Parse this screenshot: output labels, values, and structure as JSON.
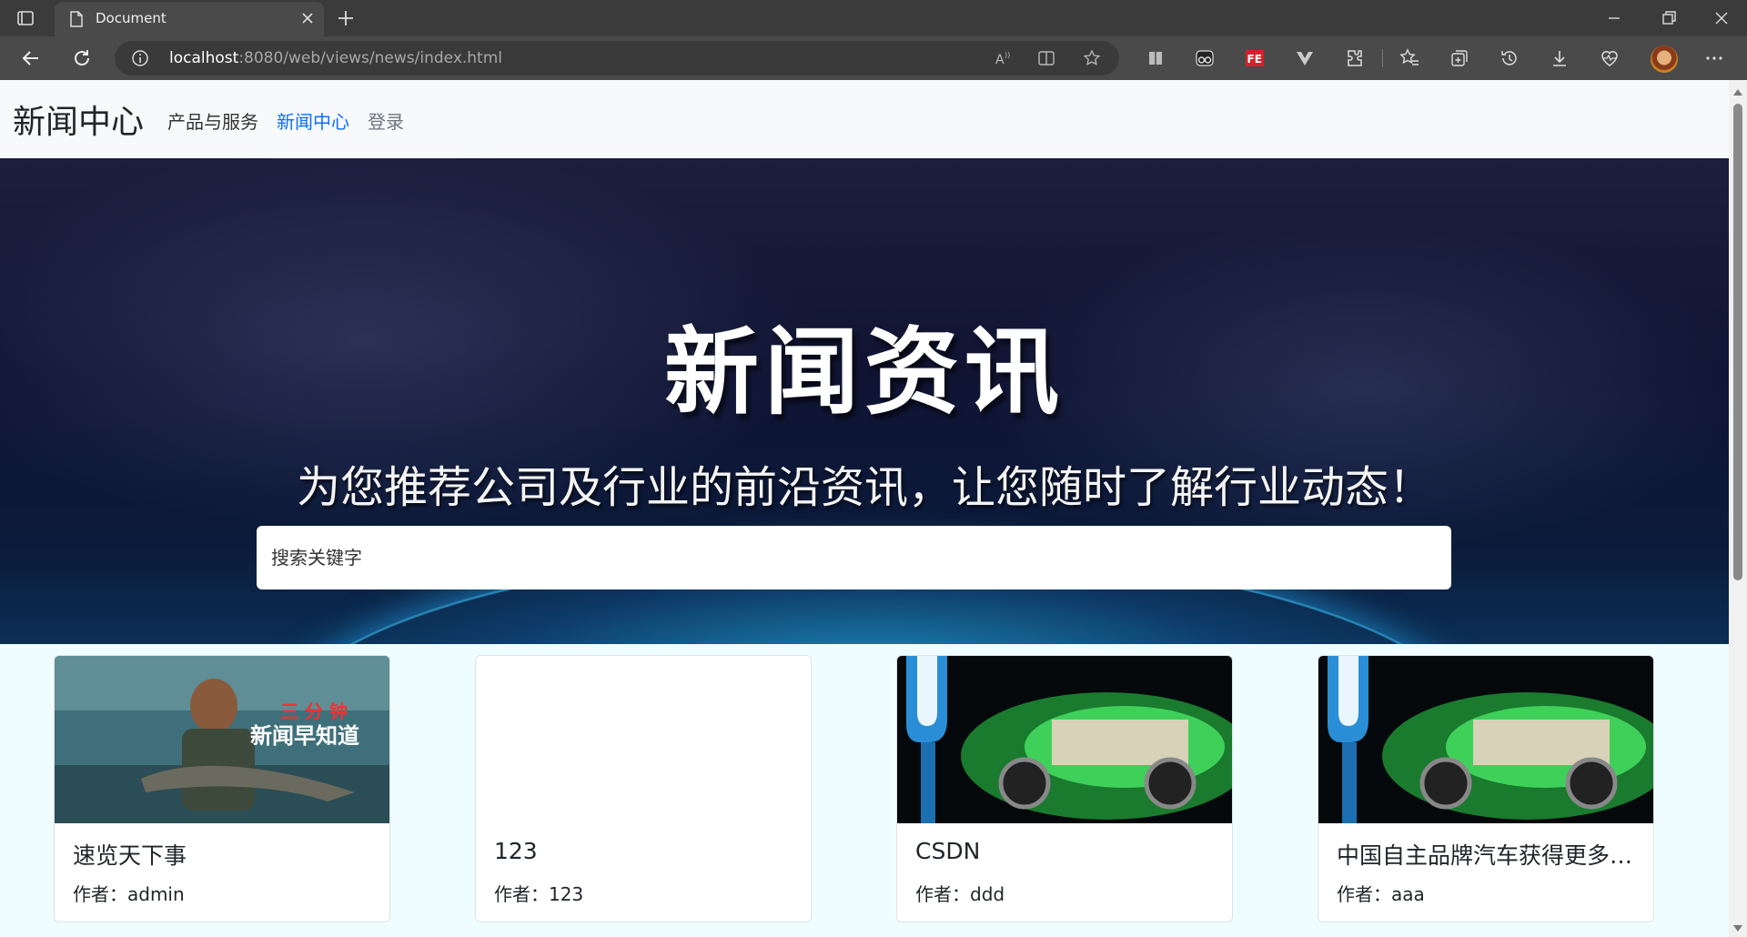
{
  "browser": {
    "tab_title": "Document",
    "url_host": "localhost",
    "url_rest": ":8080/web/views/news/index.html"
  },
  "nav": {
    "brand": "新闻中心",
    "items": [
      {
        "label": "产品与服务"
      },
      {
        "label": "新闻中心"
      },
      {
        "label": "登录"
      }
    ]
  },
  "hero": {
    "title": "新闻资讯",
    "subtitle": "为您推荐公司及行业的前沿资讯，让您随时了解行业动态！",
    "search_placeholder": "搜索关键字"
  },
  "cards": [
    {
      "title": "速览天下事",
      "author": "作者：admin",
      "image": "fish-news-photo",
      "image_caption_top": "三 分 钟",
      "image_caption_bottom": "新闻早知道"
    },
    {
      "title": "123",
      "author": "作者：123",
      "image": "none"
    },
    {
      "title": "CSDN",
      "author": "作者：ddd",
      "image": "ev-battery-car"
    },
    {
      "title": "中国自主品牌汽车获得更多认可",
      "author": "作者：aaa",
      "image": "ev-battery-car"
    }
  ],
  "colors": {
    "nav_active": "#0d6efd",
    "hero_bg": "#101433",
    "cards_bg": "#f0fdff"
  }
}
